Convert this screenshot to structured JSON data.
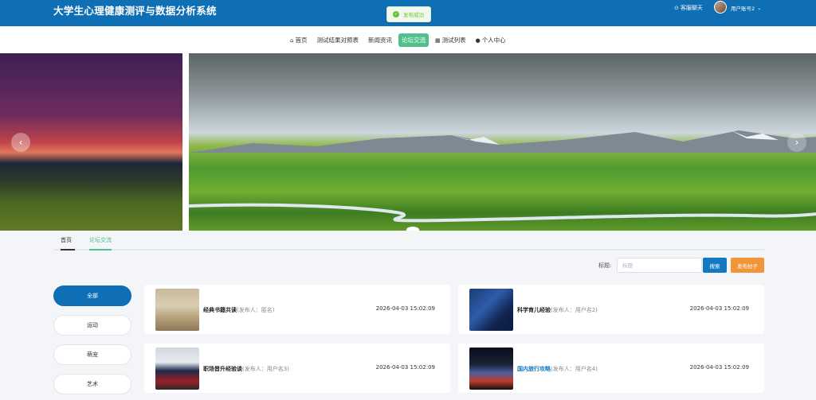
{
  "header": {
    "title": "大学生心理健康测评与数据分析系统",
    "toast": "发布成功",
    "chat": "客服聊天",
    "user": "用户账号2"
  },
  "nav": {
    "items": [
      {
        "label": "首页",
        "icon": "home-icon"
      },
      {
        "label": "测试结果对照表"
      },
      {
        "label": "新闻资讯"
      },
      {
        "label": "论坛交流",
        "active": true
      },
      {
        "label": "测试列表",
        "icon": "grid-icon"
      },
      {
        "label": "个人中心",
        "icon": "user-icon"
      }
    ]
  },
  "breadcrumb": {
    "home": "首页",
    "current": "论坛交流"
  },
  "search": {
    "label": "标题:",
    "placeholder": "标题",
    "search_btn": "搜索",
    "post_btn": "发布帖子"
  },
  "categories": [
    "全部",
    "运动",
    "萌宠",
    "艺术"
  ],
  "posts": [
    {
      "title": "经典书籍共读",
      "author": "(发布人：匿名)",
      "date": "2026-04-03 15:02:09"
    },
    {
      "title": "科学育儿经验",
      "author": "(发布人：用户名2)",
      "date": "2026-04-03 15:02:09"
    },
    {
      "title": "职场晋升经验谈",
      "author": "(发布人：用户名3)",
      "date": "2026-04-03 15:02:09"
    },
    {
      "title": "国内旅行攻略",
      "author": "(发布人：用户名4)",
      "date": "2026-04-03 15:02:09"
    }
  ],
  "colors": {
    "header_bg": "#0e6fb4",
    "active_green": "#52c08c",
    "search_blue": "#1278c2",
    "post_orange": "#f0953a"
  }
}
